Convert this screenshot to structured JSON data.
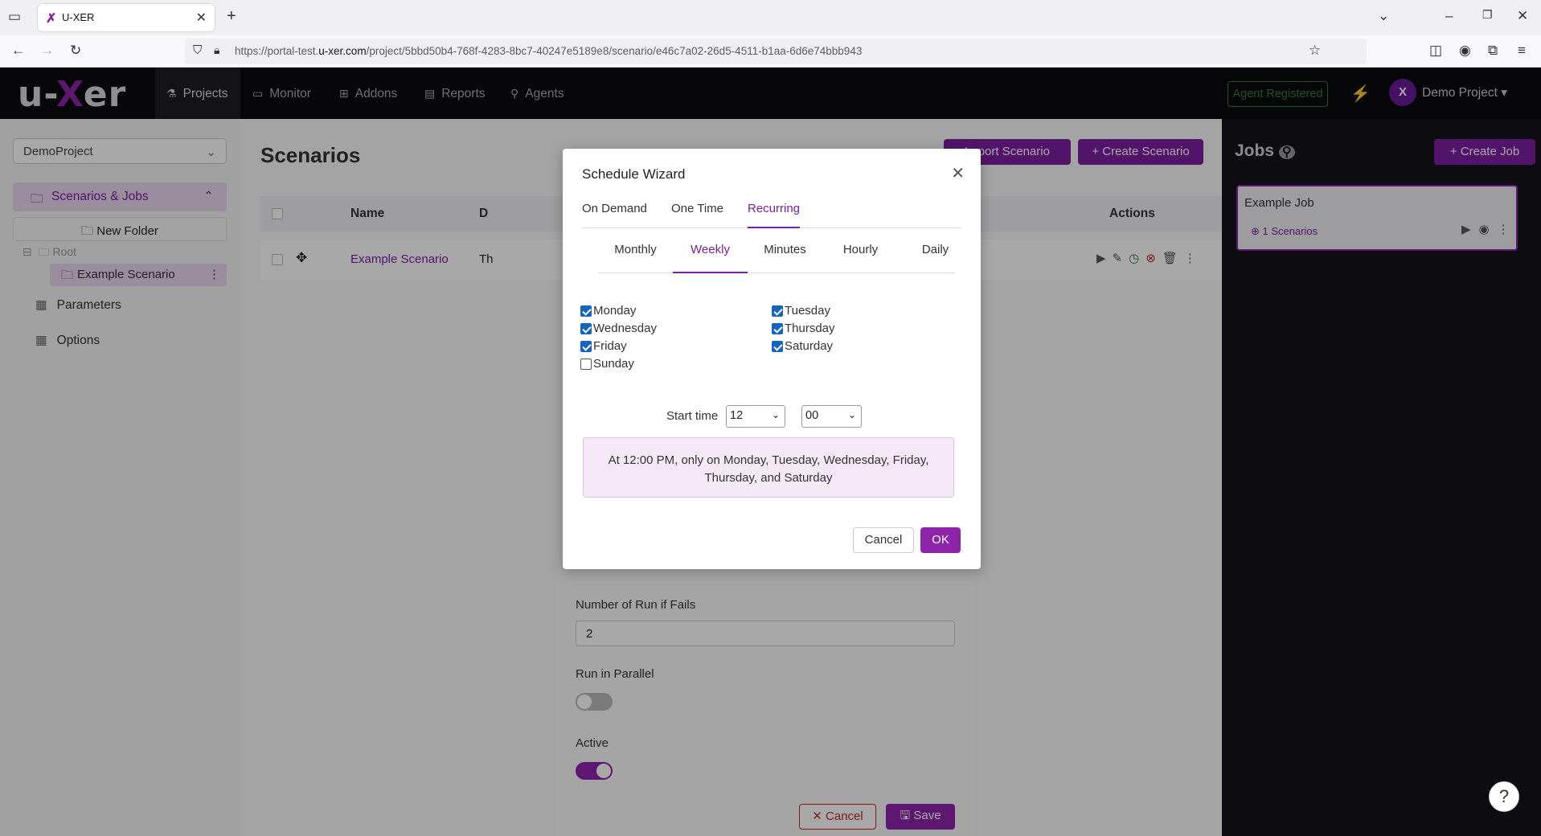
{
  "browser": {
    "tab_title": "U-XER",
    "url_prefix": "https://portal-test.",
    "url_domain": "u-xer.com",
    "url_path": "/project/5bbd50b4-768f-4283-8bc7-40247e5189e8/scenario/e46c7a02-26d5-4511-b1aa-6d6e74bbb943"
  },
  "app": {
    "logo_pre": "u-",
    "logo_x": "X",
    "logo_post": "er",
    "nav": [
      {
        "label": "Projects",
        "icon": "flask-icon"
      },
      {
        "label": "Monitor",
        "icon": "monitor-icon"
      },
      {
        "label": "Addons",
        "icon": "grid-icon"
      },
      {
        "label": "Reports",
        "icon": "document-icon"
      },
      {
        "label": "Agents",
        "icon": "agent-icon"
      }
    ],
    "agent_status": "Agent Registered",
    "project_name": "Demo Project",
    "avatar_letter": "X"
  },
  "sidebar": {
    "project_select": "DemoProject",
    "section": "Scenarios & Jobs",
    "new_folder": "New Folder",
    "root": "Root",
    "scenario": "Example Scenario",
    "links": [
      "Parameters",
      "Options"
    ]
  },
  "main": {
    "title": "Scenarios",
    "import_btn": "Import Scenario",
    "create_btn": "Create Scenario",
    "columns": [
      "Name",
      "D",
      "Actions"
    ],
    "row": {
      "name": "Example Scenario",
      "desc": "Th"
    }
  },
  "jobs": {
    "title": "Jobs",
    "create_btn": "Create Job",
    "job_name": "Example Job",
    "job_scenarios": "1 Scenarios"
  },
  "under_form": {
    "retries_label": "Number of Run if Fails",
    "retries_value": "2",
    "parallel_label": "Run in Parallel",
    "parallel_on": false,
    "active_label": "Active",
    "active_on": true,
    "cancel": "Cancel",
    "save": "Save"
  },
  "modal": {
    "title": "Schedule Wizard",
    "tabs": [
      "On Demand",
      "One Time",
      "Recurring"
    ],
    "active_tab": "Recurring",
    "subtabs": [
      "Monthly",
      "Weekly",
      "Minutes",
      "Hourly",
      "Daily"
    ],
    "active_subtab": "Weekly",
    "days": [
      {
        "label": "Monday",
        "checked": true
      },
      {
        "label": "Tuesday",
        "checked": true
      },
      {
        "label": "Wednesday",
        "checked": true
      },
      {
        "label": "Thursday",
        "checked": true
      },
      {
        "label": "Friday",
        "checked": true
      },
      {
        "label": "Saturday",
        "checked": true
      },
      {
        "label": "Sunday",
        "checked": false
      }
    ],
    "start_time_label": "Start time",
    "hour": "12",
    "minute": "00",
    "summary": "At 12:00 PM, only on Monday, Tuesday, Wednesday, Friday, Thursday, and Saturday",
    "cancel": "Cancel",
    "ok": "OK"
  },
  "colors": {
    "accent": "#8e24aa",
    "success": "#2e7d32"
  }
}
